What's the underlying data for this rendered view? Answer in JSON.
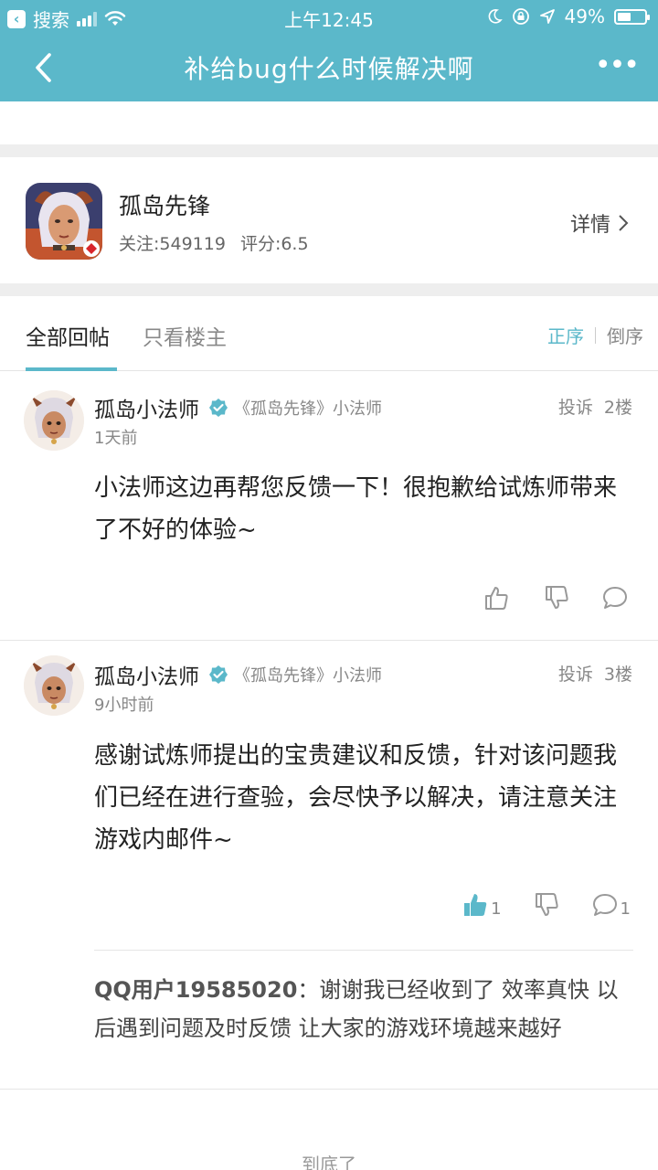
{
  "status_bar": {
    "back_app": "搜索",
    "time": "上午12:45",
    "battery": "49%",
    "battery_level": 0.49
  },
  "header": {
    "title": "补给bug什么时候解决啊",
    "more": "•••"
  },
  "game": {
    "name": "孤岛先锋",
    "follow": "关注:549119",
    "score": "评分:6.5",
    "detail": "详情"
  },
  "tabs": {
    "all": "全部回帖",
    "owner_only": "只看楼主",
    "sort_asc": "正序",
    "sort_desc": "倒序"
  },
  "posts": [
    {
      "author": "孤岛小法师",
      "tag": "《孤岛先锋》小法师",
      "time": "1天前",
      "report": "投诉",
      "floor": "2楼",
      "body": "小法师这边再帮您反馈一下！很抱歉给试炼师带来了不好的体验~",
      "likes": "",
      "comments": ""
    },
    {
      "author": "孤岛小法师",
      "tag": "《孤岛先锋》小法师",
      "time": "9小时前",
      "report": "投诉",
      "floor": "3楼",
      "body": "感谢试炼师提出的宝贵建议和反馈，针对该问题我们已经在进行查验，会尽快予以解决，请注意关注游戏内邮件~",
      "likes": "1",
      "comments": "1",
      "reply": {
        "user": "QQ用户19585020",
        "text": "：谢谢我已经收到了 效率真快 以后遇到问题及时反馈 让大家的游戏环境越来越好"
      }
    }
  ],
  "footer": {
    "end_text": "到底了"
  },
  "colors": {
    "accent": "#5bb8ca",
    "liked": "#5bb8ca"
  }
}
